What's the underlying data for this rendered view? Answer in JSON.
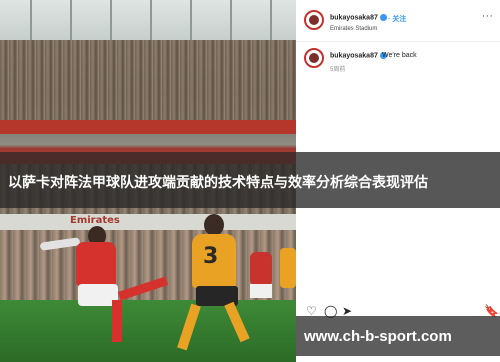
{
  "post": {
    "username": "bukayosaka87",
    "follow_label": "· 关注",
    "location": "Emirates Stadium",
    "caption": "We're back",
    "time": "5周前",
    "more_label": "···"
  },
  "stadium": {
    "board_text": "Emirates"
  },
  "player": {
    "number": "3"
  },
  "actions": {
    "heart": "♡",
    "comment": "◯",
    "share": "➤",
    "bookmark": "🔖"
  },
  "overlay": {
    "title": "以萨卡对阵法甲球队进攻端贡献的技术特点与效率分析综合表现评估"
  },
  "watermark": {
    "text": "www.ch-b-sport.com"
  },
  "colors": {
    "accent": "#3897f0",
    "arsenal_red": "#d6322d",
    "wolves_gold": "#e9a224"
  }
}
